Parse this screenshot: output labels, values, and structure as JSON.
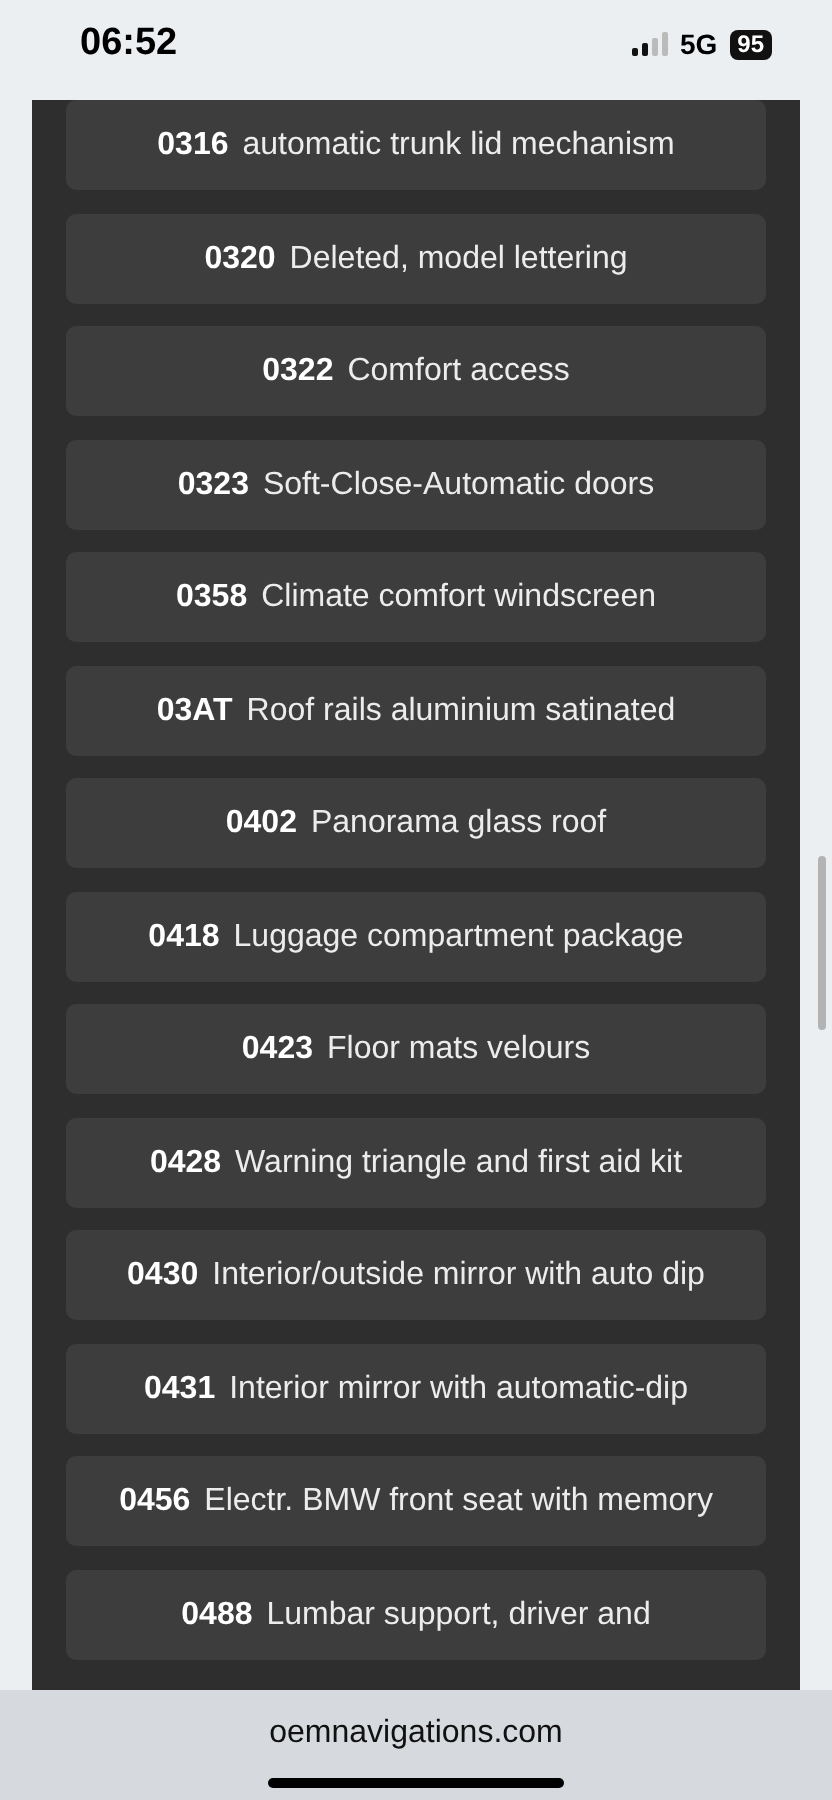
{
  "status_bar": {
    "time": "06:52",
    "network": "5G",
    "battery": "95"
  },
  "options": [
    {
      "code": "0316",
      "description": "automatic trunk lid mechanism"
    },
    {
      "code": "0320",
      "description": "Deleted, model lettering"
    },
    {
      "code": "0322",
      "description": "Comfort access"
    },
    {
      "code": "0323",
      "description": "Soft-Close-Automatic doors"
    },
    {
      "code": "0358",
      "description": "Climate comfort windscreen"
    },
    {
      "code": "03AT",
      "description": "Roof rails aluminium satinated"
    },
    {
      "code": "0402",
      "description": "Panorama glass roof"
    },
    {
      "code": "0418",
      "description": "Luggage compartment package"
    },
    {
      "code": "0423",
      "description": "Floor mats velours"
    },
    {
      "code": "0428",
      "description": "Warning triangle and first aid kit"
    },
    {
      "code": "0430",
      "description": "Interior/outside mirror with auto dip"
    },
    {
      "code": "0431",
      "description": "Interior mirror with automatic-dip"
    },
    {
      "code": "0456",
      "description": "Electr. BMW front seat with memory"
    },
    {
      "code": "0488",
      "description": "Lumbar support, driver and"
    }
  ],
  "address_bar": {
    "url": "oemnavigations.com"
  }
}
